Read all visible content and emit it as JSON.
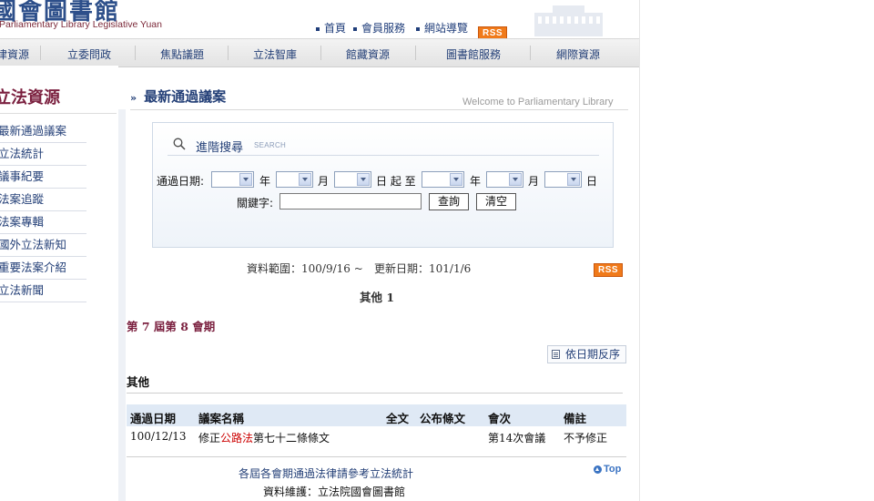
{
  "header": {
    "logo_cn": "國會圖書館",
    "logo_en": "Parliamentary Library Legislative Yuan",
    "top_links": [
      "首頁",
      "會員服務",
      "網站導覽"
    ],
    "rss_label": "RSS"
  },
  "main_nav": [
    "法律資源",
    "立委問政",
    "焦點議題",
    "立法智庫",
    "館藏資源",
    "圖書館服務",
    "網際資源"
  ],
  "sidebar": {
    "title": "立法資源",
    "items": [
      "最新通過議案",
      "立法統計",
      "議事紀要",
      "法案追蹤",
      "法案專輯",
      "國外立法新知",
      "重要法案介紹",
      "立法新聞"
    ]
  },
  "content": {
    "section_title": "最新通過議案",
    "welcome": "Welcome to Parliamentary Library",
    "search": {
      "title": "進階搜尋",
      "subtitle": "SEARCH",
      "date_label": "通過日期:",
      "year": "年",
      "month": "月",
      "day_from": "日 起 至",
      "day": "日",
      "keyword_label": "關鍵字:",
      "keyword_value": "",
      "query_button": "查詢",
      "clear_button": "清空"
    },
    "data_range_label": "資料範圍：",
    "data_range_value": "100/9/16 ~",
    "update_label": "更新日期：",
    "update_value": "101/1/6",
    "rss_label": "RSS",
    "category_count": "其他 1",
    "session": "第 7 屆第 8 會期",
    "sort_button": "依日期反序",
    "category": "其他",
    "table": {
      "headers": [
        "通過日期",
        "議案名稱",
        "全文",
        "公布條文",
        "會次",
        "備註"
      ],
      "rows": [
        {
          "date": "100/12/13",
          "name_prefix": "修正",
          "name_highlight": "公路法",
          "name_suffix": "第七十二條條文",
          "session": "第14次會議",
          "note": "不予修正"
        }
      ]
    },
    "footer_link": "各屆各會期通過法律請參考立法統計",
    "footer_maintainer": "資料維護：立法院國會圖書館",
    "top_link": "Top"
  },
  "colors": {
    "nav_text": "#233f77",
    "accent_red": "#7a1f3e",
    "rss_orange": "#f07a1a",
    "table_header_bg": "#dfe9f5"
  }
}
